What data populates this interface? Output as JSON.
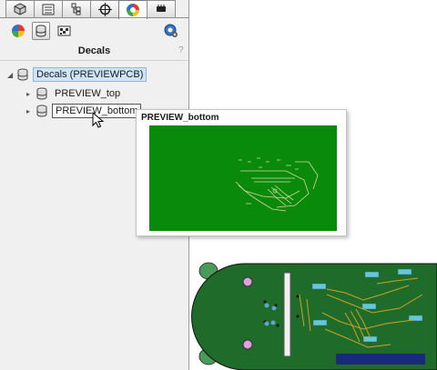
{
  "toolbar_tabs": [
    {
      "icon": "cube-icon"
    },
    {
      "icon": "list-icon"
    },
    {
      "icon": "config-icon"
    },
    {
      "icon": "crosshair-icon"
    },
    {
      "icon": "appearance-icon",
      "active": true
    },
    {
      "icon": "chip-icon"
    }
  ],
  "panel": {
    "title": "Decals",
    "help": "?"
  },
  "tree": {
    "root": {
      "label": "Decals (PREVIEWPCB)",
      "expanded": true
    },
    "items": [
      {
        "label": "PREVIEW_top"
      },
      {
        "label": "PREVIEW_bottom",
        "selected": true
      }
    ]
  },
  "tooltip": {
    "title": "PREVIEW_bottom"
  },
  "colors": {
    "pcb_green": "#0a8a0a",
    "board_green": "#1f6b2a",
    "copper": "#c9a227",
    "pad_cyan": "#66c7d9",
    "selection_blue": "#cfe4f7"
  }
}
